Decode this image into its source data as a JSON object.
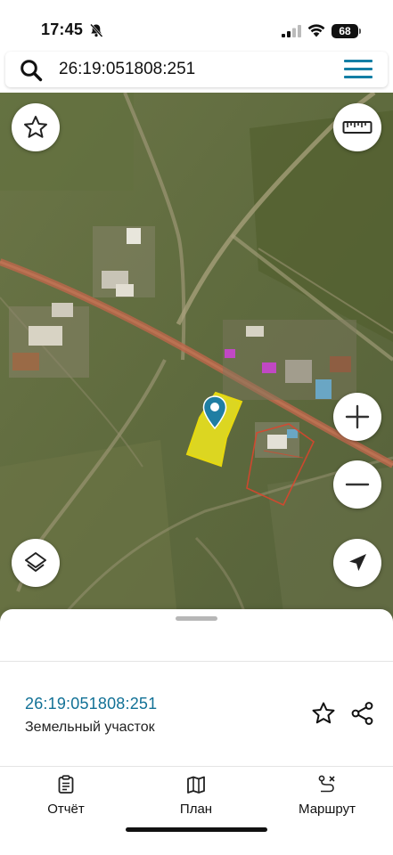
{
  "status_bar": {
    "time": "17:45",
    "battery": "68"
  },
  "search": {
    "query": "26:19:051808:251"
  },
  "map": {
    "icons": [
      "star-icon",
      "ruler-icon",
      "zoom-in-icon",
      "zoom-out-icon",
      "layers-icon",
      "locate-icon",
      "map-pin-icon"
    ],
    "colors": {
      "selected_parcel": "#f2ea1c",
      "other_parcel": "#e0432b",
      "pin": "#1f7ea3"
    }
  },
  "sheet": {
    "cadastral_number": "26:19:051808:251",
    "object_type": "Земельный участок",
    "tabs": [
      {
        "label": "Отчёт",
        "icon": "report-icon"
      },
      {
        "label": "План",
        "icon": "plan-map-icon"
      },
      {
        "label": "Маршрут",
        "icon": "route-icon"
      }
    ]
  },
  "colors": {
    "accent": "#137ea5",
    "cadastral_text": "#127196"
  }
}
